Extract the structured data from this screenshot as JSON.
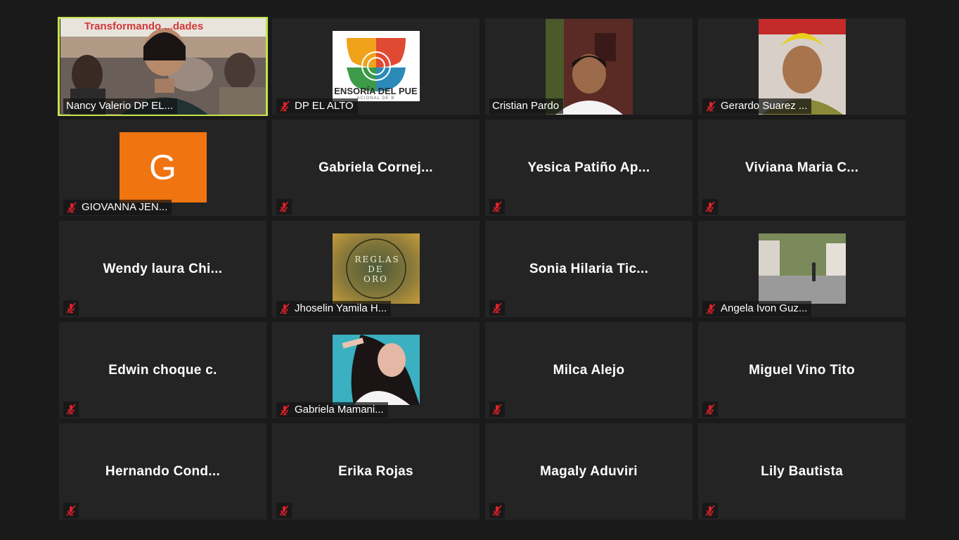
{
  "participants": [
    {
      "name": "Nancy Valerio DP EL...",
      "muted": false,
      "active": true,
      "banner_text": "Transformando ...dades"
    },
    {
      "name": "DP EL ALTO",
      "muted": true,
      "logo_text": "ENSORÍA DEL PUE",
      "logo_subtext": "ACIONAL DE B"
    },
    {
      "name": "Cristian Pardo",
      "muted": false
    },
    {
      "name": "Gerardo Suarez ...",
      "muted": true
    },
    {
      "name": "GIOVANNA JEN...",
      "muted": true,
      "avatar_letter": "G",
      "avatar_color": "#f07410"
    },
    {
      "name": "Gabriela  Cornej...",
      "muted": true
    },
    {
      "name": "Yesica  Patiño  Ap...",
      "muted": true
    },
    {
      "name": "Viviana  Maria  C...",
      "muted": true
    },
    {
      "name": "Wendy  laura  Chi...",
      "muted": true
    },
    {
      "name": "Jhoselin Yamila H...",
      "muted": true,
      "image_text": "REGLAS DE ORO"
    },
    {
      "name": "Sonia  Hilaria  Tic...",
      "muted": true
    },
    {
      "name": "Angela Ivon Guz...",
      "muted": true
    },
    {
      "name": "Edwin choque c.",
      "muted": true
    },
    {
      "name": "Gabriela Mamani...",
      "muted": true
    },
    {
      "name": "Milca Alejo",
      "muted": true
    },
    {
      "name": "Miguel Vino Tito",
      "muted": true
    },
    {
      "name": "Hernando  Cond...",
      "muted": true
    },
    {
      "name": "Erika Rojas",
      "muted": true
    },
    {
      "name": "Magaly Aduviri",
      "muted": true
    },
    {
      "name": "Lily Bautista",
      "muted": true
    }
  ],
  "colors": {
    "background": "#1a1a1a",
    "tile": "#242424",
    "active_speaker": "#c6e34a",
    "muted_icon": "#e0202a"
  }
}
